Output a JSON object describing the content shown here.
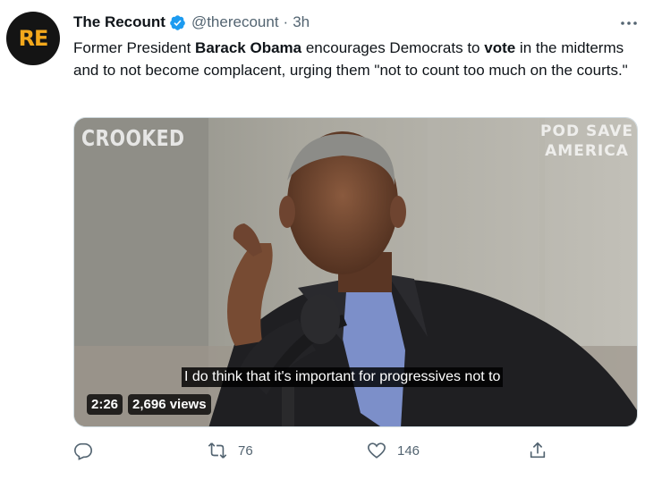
{
  "tweet": {
    "avatar_text": "RE",
    "display_name": "The Recount",
    "handle": "@therecount",
    "separator": "·",
    "time": "3h",
    "text": {
      "p1": "Former President ",
      "b1": "Barack Obama",
      "p2": " encourages Democrats to ",
      "b2": "vote",
      "p3": " in the midterms and to not become complacent, urging them \"not to count too much on the courts.\""
    },
    "media": {
      "watermark_left": "CROOKED",
      "watermark_right_line1": "POD SAVE",
      "watermark_right_line2": "AMERICA",
      "caption": "I do think that it's important for progressives not to",
      "duration": "2:26",
      "views": "2,696 views"
    },
    "actions": {
      "retweets": "76",
      "likes": "146"
    }
  },
  "colors": {
    "accent": "#1d9bf0",
    "text": "#0f1419",
    "secondary": "#536471",
    "brand": "#f3a81c"
  },
  "icons": [
    "verified-icon",
    "more-icon",
    "reply-icon",
    "retweet-icon",
    "like-icon",
    "share-icon"
  ]
}
